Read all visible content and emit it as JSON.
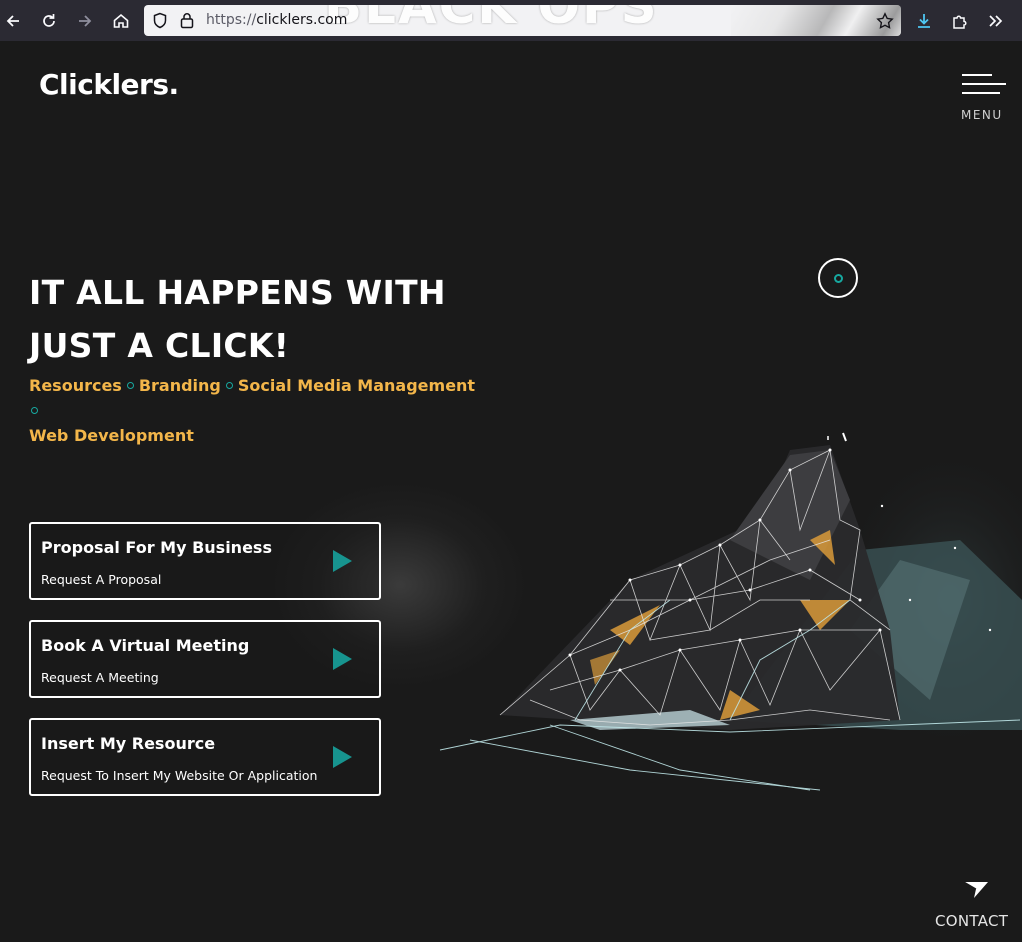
{
  "browser": {
    "url_scheme": "https://",
    "url_host": "clicklers.com",
    "ghost_banner": "BLACK OPS"
  },
  "site": {
    "logo": "Clicklers.",
    "menu_label": "MENU",
    "headline_line1": "IT ALL HAPPENS WITH",
    "headline_line2": "JUST A CLICK!",
    "services": [
      "Resources",
      "Branding",
      "Social Media Management",
      "Web Development"
    ],
    "cards": [
      {
        "title": "Proposal For My Business",
        "subtitle": "Request A Proposal"
      },
      {
        "title": "Book A Virtual Meeting",
        "subtitle": "Request A Meeting"
      },
      {
        "title": "Insert My Resource",
        "subtitle": "Request To Insert My Website Or Application"
      }
    ],
    "contact_label": "CONTACT"
  },
  "colors": {
    "background": "#1a1a1a",
    "accent_gold": "#f3b64a",
    "accent_teal": "#17948f"
  },
  "icons": [
    "back-icon",
    "reload-icon",
    "forward-icon",
    "home-icon",
    "shield-icon",
    "lock-icon",
    "star-icon",
    "download-icon",
    "extensions-icon",
    "overflow-icon",
    "menu-icon",
    "play-icon",
    "send-icon"
  ]
}
